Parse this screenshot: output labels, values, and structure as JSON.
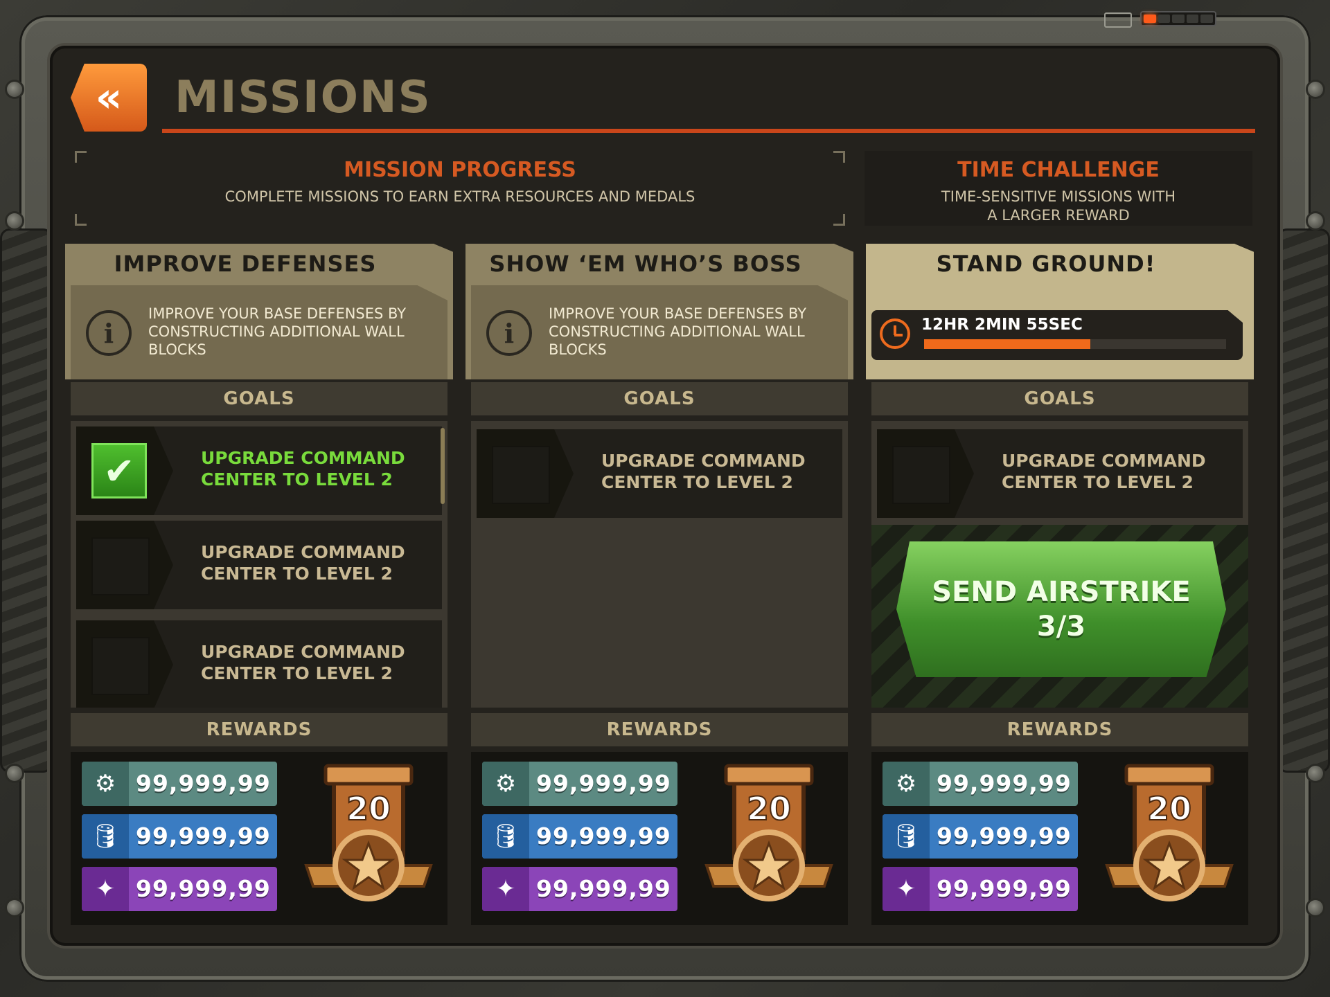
{
  "header": {
    "title": "MISSIONS",
    "back_label": "«"
  },
  "status": {
    "charge_total": 5,
    "charge_filled": 1
  },
  "mission_progress": {
    "title": "MISSION PROGRESS",
    "subtitle": "COMPLETE MISSIONS TO EARN EXTRA RESOURCES AND MEDALS"
  },
  "time_challenge": {
    "title": "TIME CHALLENGE",
    "subtitle_line1": "TIME-SENSITIVE MISSIONS WITH",
    "subtitle_line2": "A LARGER REWARD"
  },
  "labels": {
    "goals": "GOALS",
    "rewards": "REWARDS",
    "info": "i"
  },
  "cards": [
    {
      "title": "IMPROVE DEFENSES",
      "description": "IMPROVE YOUR BASE DEFENSES BY CONSTRUCTING ADDITIONAL WALL BLOCKS",
      "goals": [
        {
          "text": "UPGRADE COMMAND CENTER TO LEVEL 2",
          "done": true
        },
        {
          "text": "UPGRADE COMMAND CENTER TO LEVEL 2",
          "done": false
        },
        {
          "text": "UPGRADE COMMAND CENTER TO LEVEL 2",
          "done": false
        }
      ],
      "rewards": {
        "bolts": "99,999,99",
        "oil": "99,999,99",
        "crystals": "99,999,99",
        "medal": "20"
      }
    },
    {
      "title": "SHOW ‘EM WHO’S BOSS",
      "description": "IMPROVE YOUR BASE DEFENSES BY CONSTRUCTING ADDITIONAL WALL BLOCKS",
      "goals": [
        {
          "text": "UPGRADE COMMAND CENTER TO LEVEL 2",
          "done": false
        }
      ],
      "rewards": {
        "bolts": "99,999,99",
        "oil": "99,999,99",
        "crystals": "99,999,99",
        "medal": "20"
      }
    },
    {
      "title": "STAND GROUND!",
      "timer": {
        "text": "12HR 2MIN 55SEC",
        "progress": 0.55
      },
      "goals": [
        {
          "text": "UPGRADE COMMAND CENTER TO LEVEL 2",
          "done": false
        }
      ],
      "action": {
        "line1": "SEND AIRSTRIKE",
        "line2": "3/3"
      },
      "rewards": {
        "bolts": "99,999,99",
        "oil": "99,999,99",
        "crystals": "99,999,99",
        "medal": "20"
      }
    }
  ],
  "icons": {
    "bolts": "bolt-resource-icon",
    "oil": "oil-barrel-icon",
    "crystals": "crystal-icon",
    "medal": "star-medal-icon",
    "clock": "clock-icon"
  },
  "colors": {
    "accent": "#d65a22",
    "done": "#79db3c",
    "airstrike": "#4fa834"
  }
}
